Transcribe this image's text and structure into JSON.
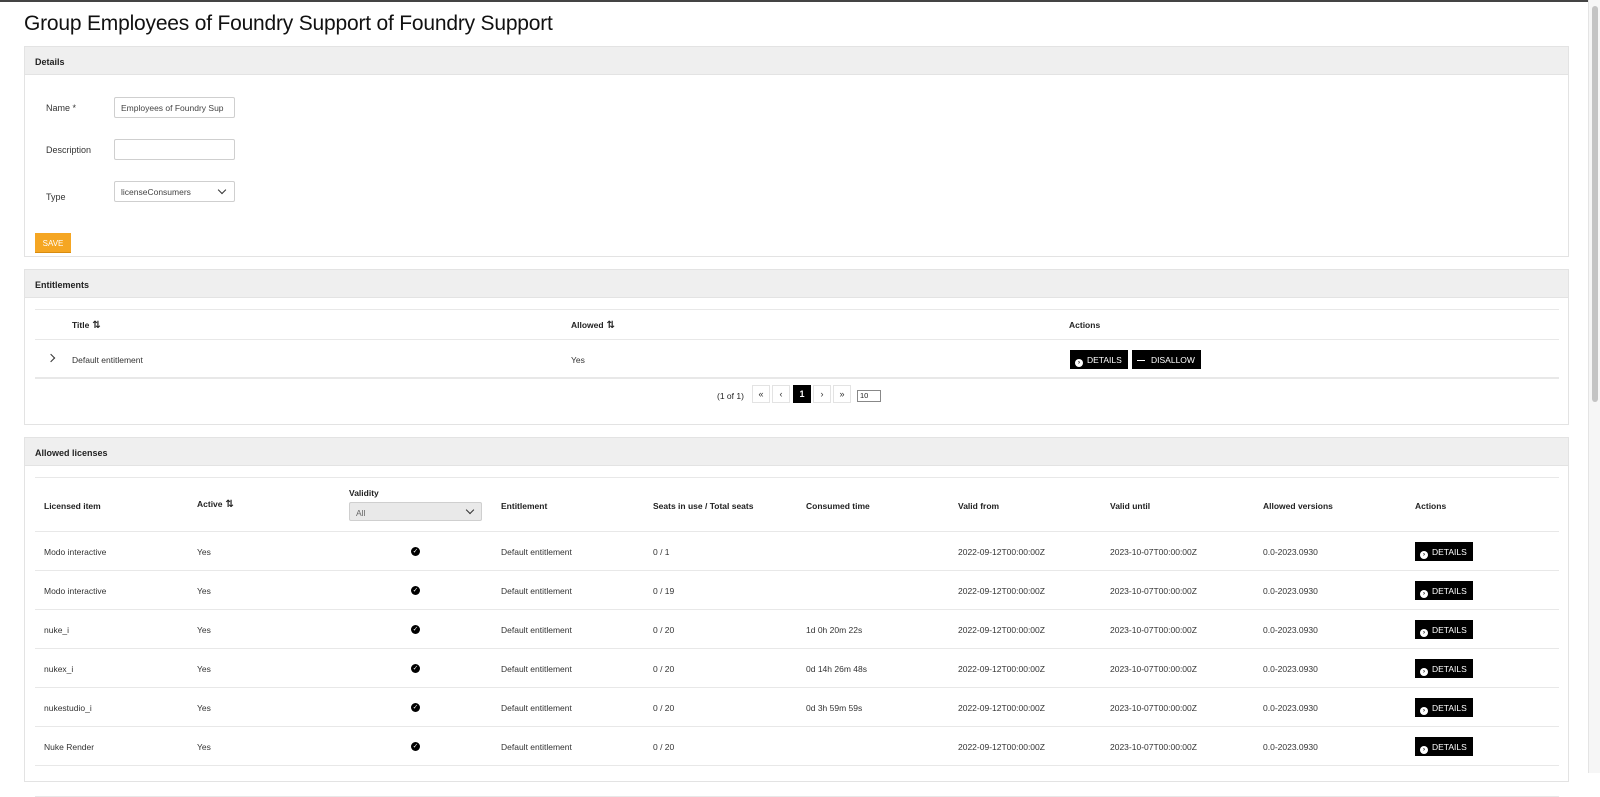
{
  "page": {
    "title": "Group Employees of Foundry Support of Foundry Support"
  },
  "details": {
    "header": "Details",
    "name_label": "Name *",
    "name_value": "Employees of Foundry Sup",
    "description_label": "Description",
    "description_value": "",
    "type_label": "Type",
    "type_value": "licenseConsumers",
    "save_label": "SAVE",
    "save_color": "#f5a623"
  },
  "entitlements": {
    "header": "Entitlements",
    "columns": {
      "title": "Title",
      "allowed": "Allowed",
      "actions": "Actions"
    },
    "sort_icon": "⇅",
    "rows": [
      {
        "title": "Default entitlement",
        "allowed": "Yes",
        "details_label": "DETAILS",
        "disallow_label": "DISALLOW"
      }
    ],
    "pager": {
      "summary": "(1 of 1)",
      "first": "«",
      "prev": "‹",
      "current": "1",
      "next": "›",
      "last": "»",
      "page_size": "10"
    }
  },
  "allowed_licenses": {
    "header": "Allowed licenses",
    "columns": {
      "licensed_item": "Licensed item",
      "active": "Active",
      "validity": "Validity",
      "validity_filter": "All",
      "entitlement": "Entitlement",
      "seats": "Seats in use / Total seats",
      "consumed": "Consumed time",
      "valid_from": "Valid from",
      "valid_until": "Valid until",
      "versions": "Allowed versions",
      "actions": "Actions"
    },
    "details_label": "DETAILS",
    "rows": [
      {
        "item": "Modo interactive",
        "active": "Yes",
        "validity_icon": "check-circle-icon",
        "entitlement": "Default entitlement",
        "seats": "0 / 1",
        "consumed": "",
        "valid_from": "2022-09-12T00:00:00Z",
        "valid_until": "2023-10-07T00:00:00Z",
        "versions": "0.0-2023.0930"
      },
      {
        "item": "Modo interactive",
        "active": "Yes",
        "validity_icon": "check-circle-icon",
        "entitlement": "Default entitlement",
        "seats": "0 / 19",
        "consumed": "",
        "valid_from": "2022-09-12T00:00:00Z",
        "valid_until": "2023-10-07T00:00:00Z",
        "versions": "0.0-2023.0930"
      },
      {
        "item": "nuke_i",
        "active": "Yes",
        "validity_icon": "check-circle-icon",
        "entitlement": "Default entitlement",
        "seats": "0 / 20",
        "consumed": "1d 0h 20m 22s",
        "valid_from": "2022-09-12T00:00:00Z",
        "valid_until": "2023-10-07T00:00:00Z",
        "versions": "0.0-2023.0930"
      },
      {
        "item": "nukex_i",
        "active": "Yes",
        "validity_icon": "check-circle-icon",
        "entitlement": "Default entitlement",
        "seats": "0 / 20",
        "consumed": "0d 14h 26m 48s",
        "valid_from": "2022-09-12T00:00:00Z",
        "valid_until": "2023-10-07T00:00:00Z",
        "versions": "0.0-2023.0930"
      },
      {
        "item": "nukestudio_i",
        "active": "Yes",
        "validity_icon": "check-circle-icon",
        "entitlement": "Default entitlement",
        "seats": "0 / 20",
        "consumed": "0d 3h 59m 59s",
        "valid_from": "2022-09-12T00:00:00Z",
        "valid_until": "2023-10-07T00:00:00Z",
        "versions": "0.0-2023.0930"
      },
      {
        "item": "Nuke Render",
        "active": "Yes",
        "validity_icon": "check-circle-icon",
        "entitlement": "Default entitlement",
        "seats": "0 / 20",
        "consumed": "",
        "valid_from": "2022-09-12T00:00:00Z",
        "valid_until": "2023-10-07T00:00:00Z",
        "versions": "0.0-2023.0930"
      }
    ]
  }
}
